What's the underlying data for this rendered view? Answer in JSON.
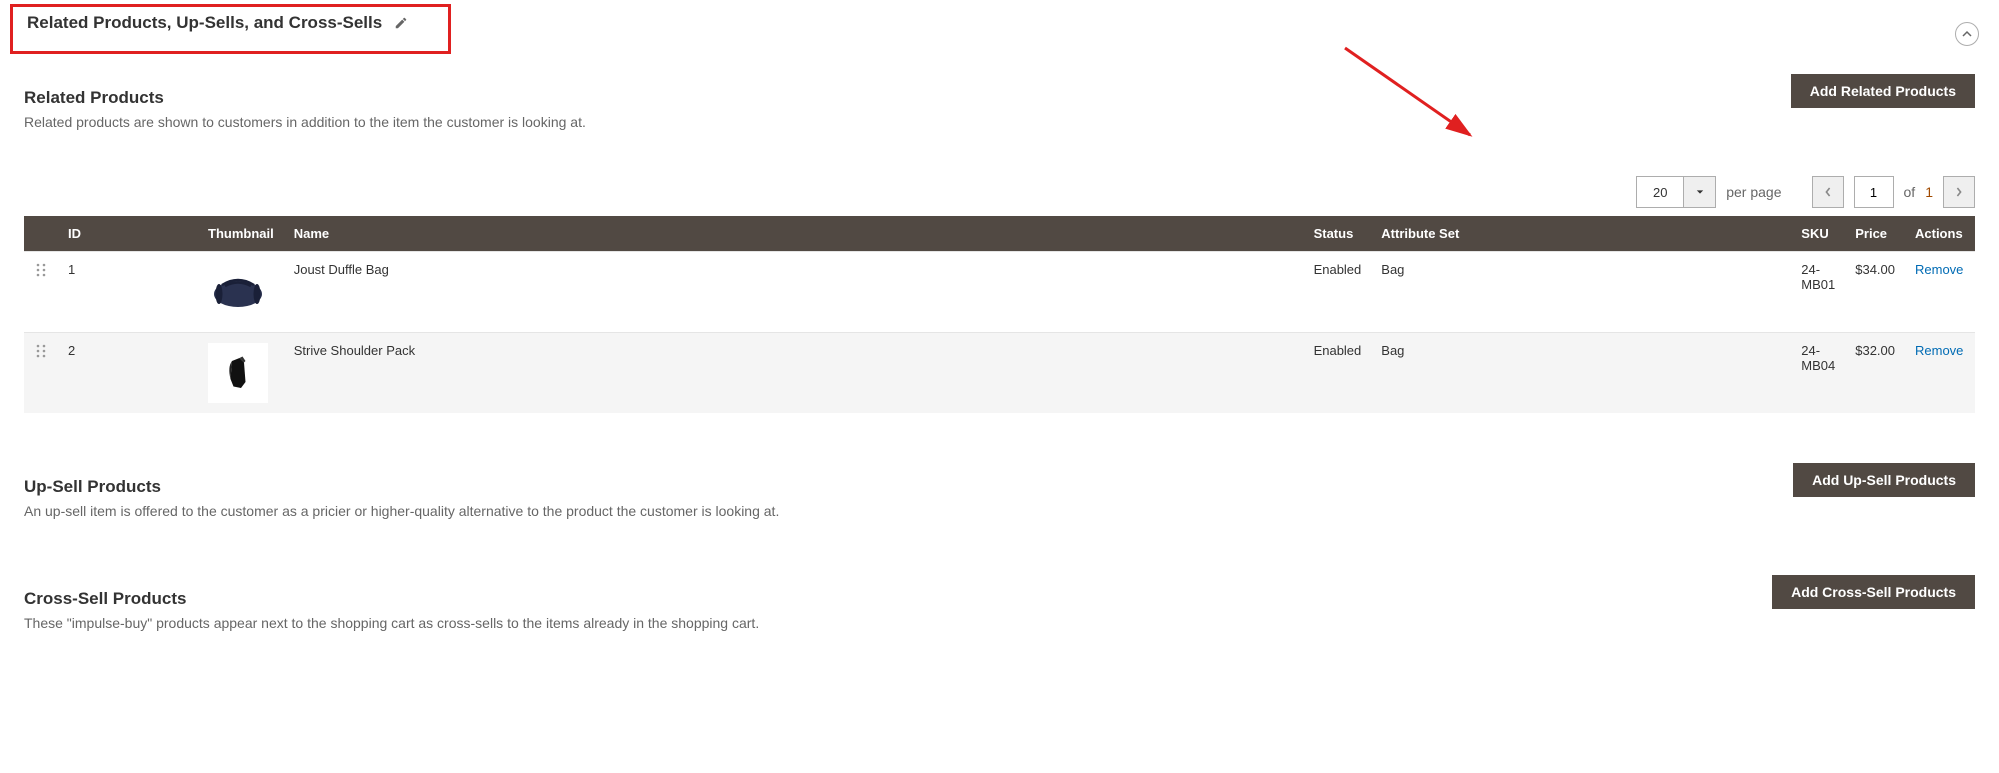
{
  "section": {
    "title": "Related Products, Up-Sells, and Cross-Sells"
  },
  "related": {
    "title": "Related Products",
    "desc": "Related products are shown to customers in addition to the item the customer is looking at.",
    "add_button": "Add Related Products",
    "pager": {
      "page_size": "20",
      "per_page_label": "per page",
      "current_page": "1",
      "of_label": "of",
      "total_pages": "1"
    },
    "columns": {
      "id": "ID",
      "thumbnail": "Thumbnail",
      "name": "Name",
      "status": "Status",
      "attribute_set": "Attribute Set",
      "sku": "SKU",
      "price": "Price",
      "actions": "Actions"
    },
    "rows": [
      {
        "id": "1",
        "name": "Joust Duffle Bag",
        "status": "Enabled",
        "attribute_set": "Bag",
        "sku": "24-MB01",
        "price": "$34.00",
        "action": "Remove"
      },
      {
        "id": "2",
        "name": "Strive Shoulder Pack",
        "status": "Enabled",
        "attribute_set": "Bag",
        "sku": "24-MB04",
        "price": "$32.00",
        "action": "Remove"
      }
    ]
  },
  "upsell": {
    "title": "Up-Sell Products",
    "desc": "An up-sell item is offered to the customer as a pricier or higher-quality alternative to the product the customer is looking at.",
    "add_button": "Add Up-Sell Products"
  },
  "crosssell": {
    "title": "Cross-Sell Products",
    "desc": "These \"impulse-buy\" products appear next to the shopping cart as cross-sells to the items already in the shopping cart.",
    "add_button": "Add Cross-Sell Products"
  }
}
